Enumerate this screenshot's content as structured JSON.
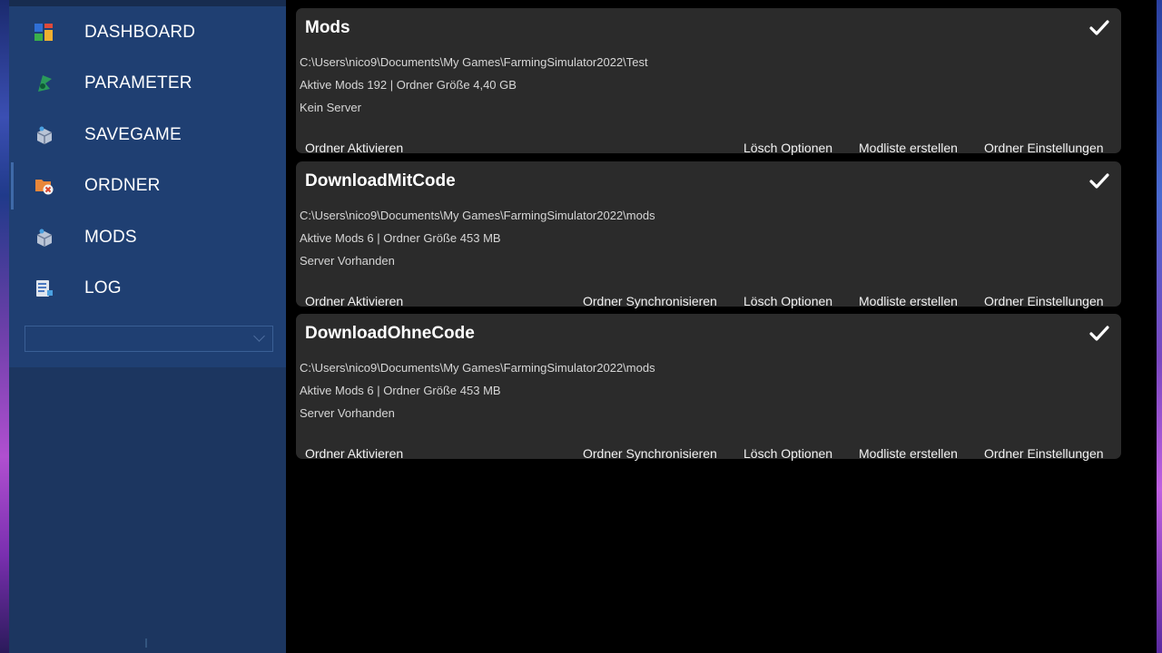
{
  "nav": [
    {
      "label": "DASHBOARD",
      "icon": "dashboard-icon"
    },
    {
      "label": "PARAMETER",
      "icon": "parameter-icon"
    },
    {
      "label": "SAVEGAME",
      "icon": "savegame-icon"
    },
    {
      "label": "ORDNER",
      "icon": "folder-icon",
      "active": true
    },
    {
      "label": "MODS",
      "icon": "mods-icon"
    },
    {
      "label": "LOG",
      "icon": "log-icon"
    }
  ],
  "selector": {
    "value": ""
  },
  "cards": [
    {
      "title": "Mods",
      "path": "C:\\Users\\nico9\\Documents\\My Games\\FarmingSimulator2022\\Test",
      "stats": "Aktive Mods 192 | Ordner Größe 4,40 GB",
      "server": "Kein Server",
      "actions": {
        "activate": "Ordner Aktivieren",
        "delete": "Lösch Optionen",
        "modlist": "Modliste erstellen",
        "settings": "Ordner Einstellungen"
      }
    },
    {
      "title": "DownloadMitCode",
      "path": "C:\\Users\\nico9\\Documents\\My Games\\FarmingSimulator2022\\mods",
      "stats": "Aktive Mods 6 | Ordner Größe 453 MB",
      "server": "Server Vorhanden",
      "actions": {
        "activate": "Ordner Aktivieren",
        "sync": "Ordner Synchronisieren",
        "delete": "Lösch Optionen",
        "modlist": "Modliste erstellen",
        "settings": "Ordner Einstellungen"
      }
    },
    {
      "title": "DownloadOhneCode",
      "path": "C:\\Users\\nico9\\Documents\\My Games\\FarmingSimulator2022\\mods",
      "stats": "Aktive Mods 6 | Ordner Größe 453 MB",
      "server": "Server Vorhanden",
      "actions": {
        "activate": "Ordner Aktivieren",
        "sync": "Ordner Synchronisieren",
        "delete": "Lösch Optionen",
        "modlist": "Modliste erstellen",
        "settings": "Ordner Einstellungen"
      }
    }
  ],
  "colors": {
    "sidebar": "#1f3f72",
    "card": "#2b2b2b",
    "background": "#000000"
  }
}
